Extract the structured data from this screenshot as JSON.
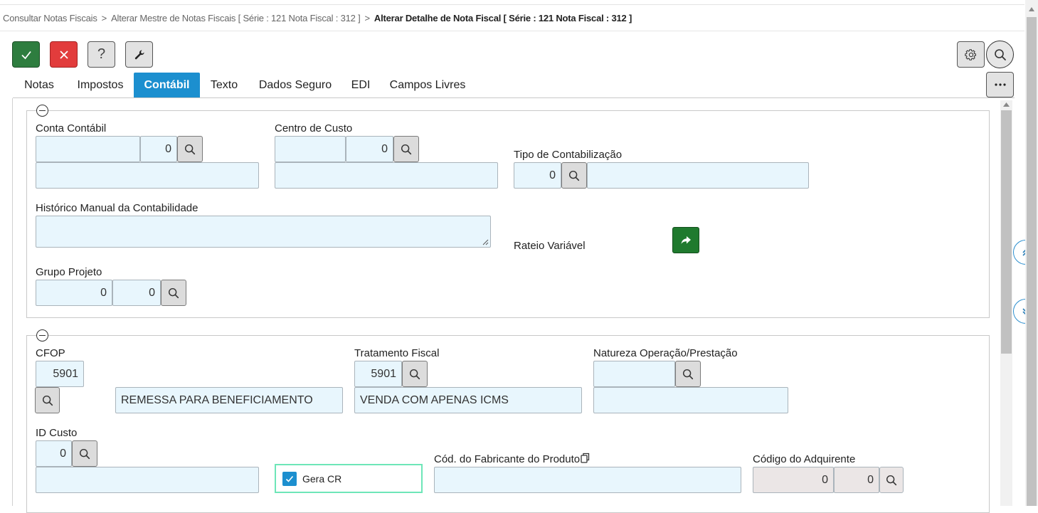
{
  "breadcrumb": {
    "items": [
      "Consultar Notas Fiscais",
      "Alterar Mestre de Notas Fiscais [ Série : 121 Nota Fiscal : 312 ]"
    ],
    "separator": ">",
    "current": "Alterar Detalhe de Nota Fiscal [ Série : 121 Nota Fiscal : 312 ]"
  },
  "toolbar": {
    "help_label": "?"
  },
  "tabs": [
    {
      "label": "Notas"
    },
    {
      "label": "Impostos"
    },
    {
      "label": "Contábil",
      "active": true
    },
    {
      "label": "Texto"
    },
    {
      "label": "Dados Seguro"
    },
    {
      "label": "EDI"
    },
    {
      "label": "Campos Livres"
    }
  ],
  "section1": {
    "conta_contabil": {
      "label": "Conta Contábil",
      "code": "",
      "number": "0",
      "description": ""
    },
    "centro_custo": {
      "label": "Centro de Custo",
      "code": "",
      "number": "0",
      "description": ""
    },
    "tipo_contabilizacao": {
      "label": "Tipo de Contabilização",
      "number": "0",
      "description": ""
    },
    "historico_manual": {
      "label": "Histórico Manual da Contabilidade",
      "value": ""
    },
    "rateio_variavel": {
      "label": "Rateio Variável"
    },
    "grupo_projeto": {
      "label": "Grupo Projeto",
      "value1": "0",
      "value2": "0"
    }
  },
  "section2": {
    "cfop": {
      "label": "CFOP",
      "value": "5901",
      "description": "REMESSA PARA BENEFICIAMENTO"
    },
    "tratamento_fiscal": {
      "label": "Tratamento Fiscal",
      "value": "5901",
      "description": "VENDA COM APENAS ICMS"
    },
    "natureza_operacao": {
      "label": "Natureza Operação/Prestação",
      "value": "",
      "description": ""
    },
    "id_custo": {
      "label": "ID Custo",
      "value": "0",
      "description": ""
    },
    "gera_cr": {
      "label": "Gera CR",
      "checked": true
    },
    "cod_fabricante": {
      "label": "Cód. do Fabricante do Produto",
      "value": ""
    },
    "codigo_adquirente": {
      "label": "Código do Adquirente",
      "value1": "0",
      "value2": "0"
    }
  },
  "colors": {
    "accent": "#1c8fcf",
    "confirm": "#2e7d3f",
    "cancel": "#e23c3c",
    "input_bg": "#e8f6fd",
    "readonly_bg": "#ebe6e6"
  },
  "icons": {
    "confirm": "check-icon",
    "cancel": "close-icon",
    "help": "question-icon",
    "tools": "wrench-icon",
    "settings": "gear-icon",
    "search": "search-icon",
    "more": "ellipsis-icon",
    "share": "share-arrow-icon",
    "scroll_up": "double-chevron-up-icon",
    "scroll_down": "double-chevron-down-icon",
    "copy": "copy-icon"
  }
}
